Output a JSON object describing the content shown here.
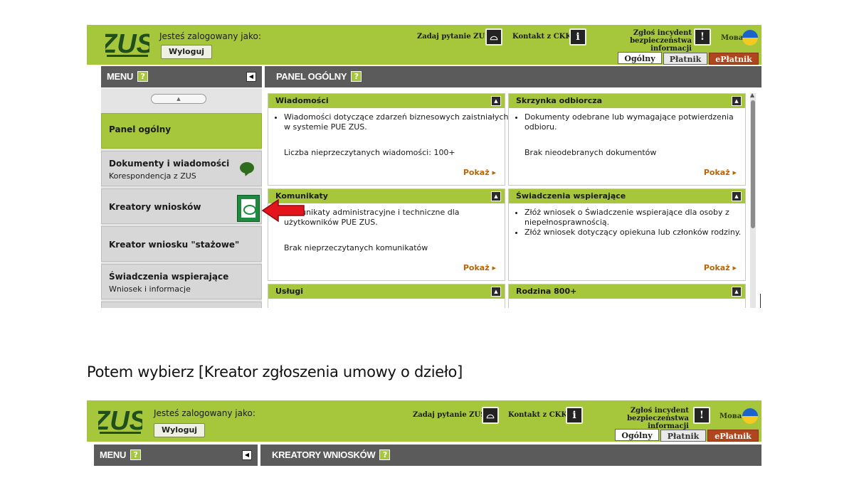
{
  "header": {
    "logo_text": "ZUS",
    "logged_in_label": "Jesteś zalogowany jako:",
    "logout_label": "Wyloguj",
    "ask_question": "Zadaj pytanie ZUS",
    "contact_ckk": "Kontakt z CKK",
    "incident_line1": "Zgłoś incydent",
    "incident_line2": "bezpieczeństwa informacji",
    "language": "Мова",
    "tabs": [
      "Ogólny",
      "Płatnik",
      "ePłatnik"
    ]
  },
  "menu": {
    "title": "MENU",
    "help": "?"
  },
  "panel": {
    "title": "PANEL OGÓLNY",
    "help": "?"
  },
  "sidebar": {
    "items": [
      {
        "title": "Panel ogólny",
        "subtitle": ""
      },
      {
        "title": "Dokumenty i wiadomości",
        "subtitle": "Korespondencja z ZUS"
      },
      {
        "title": "Kreatory wniosków",
        "subtitle": ""
      },
      {
        "title": "Kreator wniosku \"stażowe\"",
        "subtitle": ""
      },
      {
        "title": "Świadczenia wspierające",
        "subtitle": "Wniosek i informacje"
      }
    ]
  },
  "cards": {
    "wiadomosci": {
      "title": "Wiadomości",
      "bullets": [
        "Wiadomości dotyczące zdarzeń biznesowych zaistniałych w systemie PUE ZUS."
      ],
      "info": "Liczba nieprzeczytanych wiadomości: 100+",
      "more": "Pokaż"
    },
    "skrzynka": {
      "title": "Skrzynka odbiorcza",
      "bullets": [
        "Dokumenty odebrane lub wymagające potwierdzenia odbioru."
      ],
      "info": "Brak nieodebranych dokumentów",
      "more": "Pokaż"
    },
    "komunikaty": {
      "title": "Komunikaty",
      "bullets": [
        "Komunikaty administracyjne i techniczne dla użytkowników PUE ZUS."
      ],
      "info": "Brak nieprzeczytanych komunikatów",
      "more": "Pokaż"
    },
    "swiadczenia": {
      "title": "Świadczenia wspierające",
      "bullets": [
        "Złóż wniosek o Świadczenie wspierające dla osoby z niepełnosprawnością.",
        "Złóż wniosek dotyczący opiekuna lub członków rodziny."
      ],
      "more": "Pokaż"
    },
    "uslugi": {
      "title": "Usługi"
    },
    "rodzina": {
      "title": "Rodzina 800+"
    }
  },
  "caption": "Potem wybierz [Kreator zgłoszenia umowy o dzieło]",
  "panel2": {
    "title": "KREATORY WNIOSKÓW",
    "help": "?"
  },
  "colors": {
    "green": "#a6c73c",
    "dark_bar": "#5b5b5b",
    "eplatnik": "#b0461e",
    "more_link": "#b8650a",
    "arrow": "#e3141b"
  }
}
